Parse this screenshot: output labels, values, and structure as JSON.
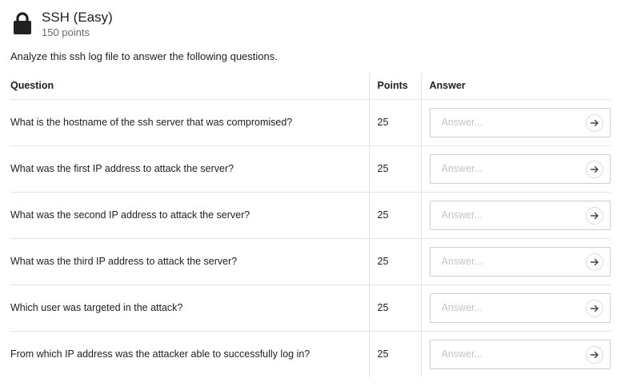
{
  "challenge": {
    "title": "SSH (Easy)",
    "points": "150 points",
    "icon": "lock-icon",
    "description": "Analyze this ssh log file to answer the following questions."
  },
  "table": {
    "headers": {
      "question": "Question",
      "points": "Points",
      "answer": "Answer"
    },
    "answer_placeholder": "Answer...",
    "rows": [
      {
        "question": "What is the hostname of the ssh server that was compromised?",
        "points": "25"
      },
      {
        "question": "What was the first IP address to attack the server?",
        "points": "25"
      },
      {
        "question": "What was the second IP address to attack the server?",
        "points": "25"
      },
      {
        "question": "What was the third IP address to attack the server?",
        "points": "25"
      },
      {
        "question": "Which user was targeted in the attack?",
        "points": "25"
      },
      {
        "question": "From which IP address was the attacker able to successfully log in?",
        "points": "25"
      }
    ]
  }
}
